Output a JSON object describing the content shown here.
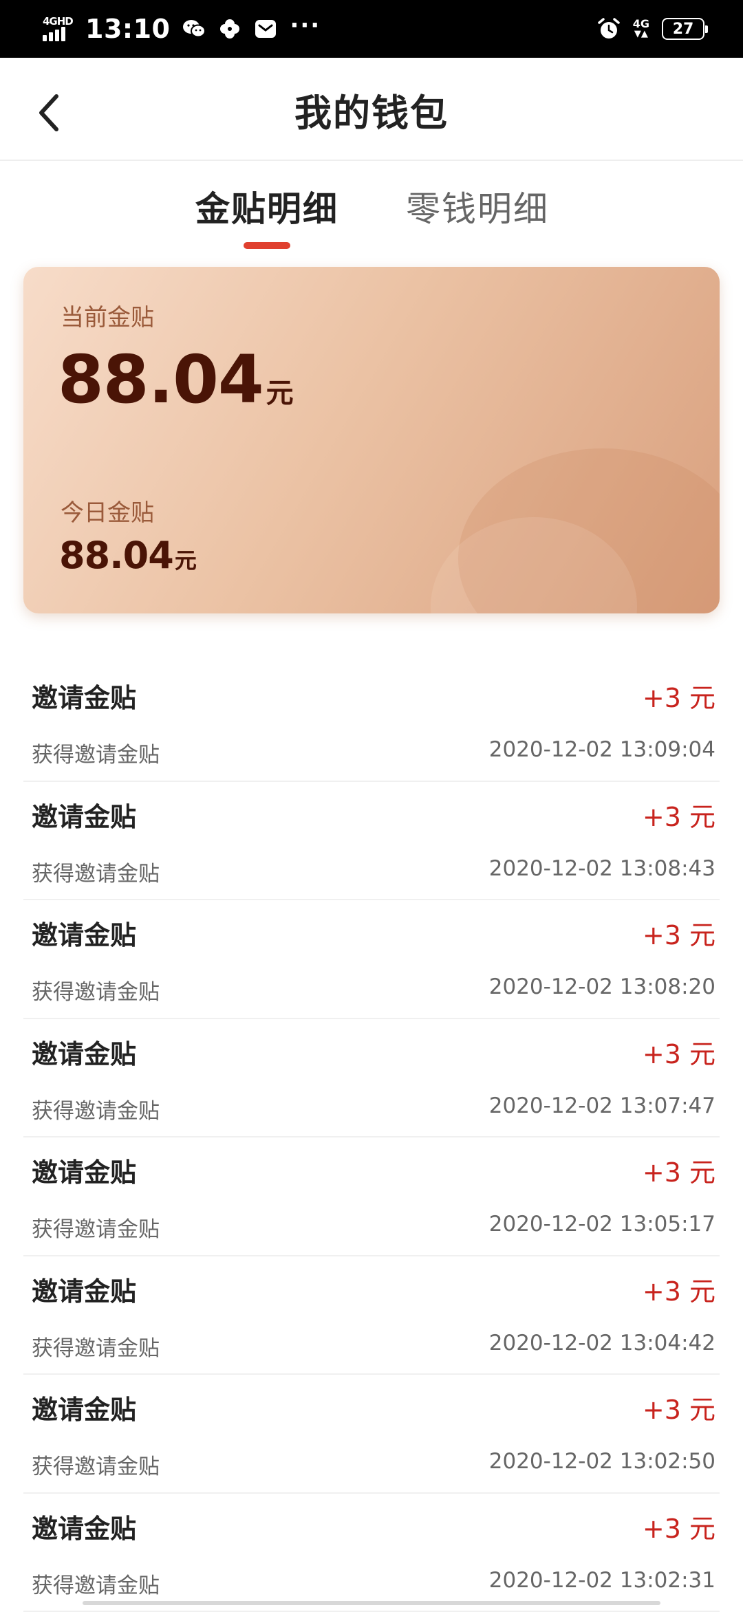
{
  "status_bar": {
    "network_left": "4GHD",
    "time": "13:10",
    "more": "···",
    "network_right": "4G",
    "battery": "27"
  },
  "header": {
    "title": "我的钱包"
  },
  "tabs": [
    {
      "label": "金贴明细",
      "active": true
    },
    {
      "label": "零钱明细",
      "active": false
    }
  ],
  "card": {
    "current_label": "当前金贴",
    "current_amount": "88.04",
    "current_unit": "元",
    "today_label": "今日金贴",
    "today_amount": "88.04",
    "today_unit": "元"
  },
  "records": [
    {
      "title": "邀请金贴",
      "amount": "+3 元",
      "desc": "获得邀请金贴",
      "time": "2020-12-02 13:09:04"
    },
    {
      "title": "邀请金贴",
      "amount": "+3 元",
      "desc": "获得邀请金贴",
      "time": "2020-12-02 13:08:43"
    },
    {
      "title": "邀请金贴",
      "amount": "+3 元",
      "desc": "获得邀请金贴",
      "time": "2020-12-02 13:08:20"
    },
    {
      "title": "邀请金贴",
      "amount": "+3 元",
      "desc": "获得邀请金贴",
      "time": "2020-12-02 13:07:47"
    },
    {
      "title": "邀请金贴",
      "amount": "+3 元",
      "desc": "获得邀请金贴",
      "time": "2020-12-02 13:05:17"
    },
    {
      "title": "邀请金贴",
      "amount": "+3 元",
      "desc": "获得邀请金贴",
      "time": "2020-12-02 13:04:42"
    },
    {
      "title": "邀请金贴",
      "amount": "+3 元",
      "desc": "获得邀请金贴",
      "time": "2020-12-02 13:02:50"
    },
    {
      "title": "邀请金贴",
      "amount": "+3 元",
      "desc": "获得邀请金贴",
      "time": "2020-12-02 13:02:31"
    }
  ],
  "colors": {
    "accent": "#e0402f",
    "amount_text": "#c8231d",
    "card_text": "#4a1406"
  }
}
